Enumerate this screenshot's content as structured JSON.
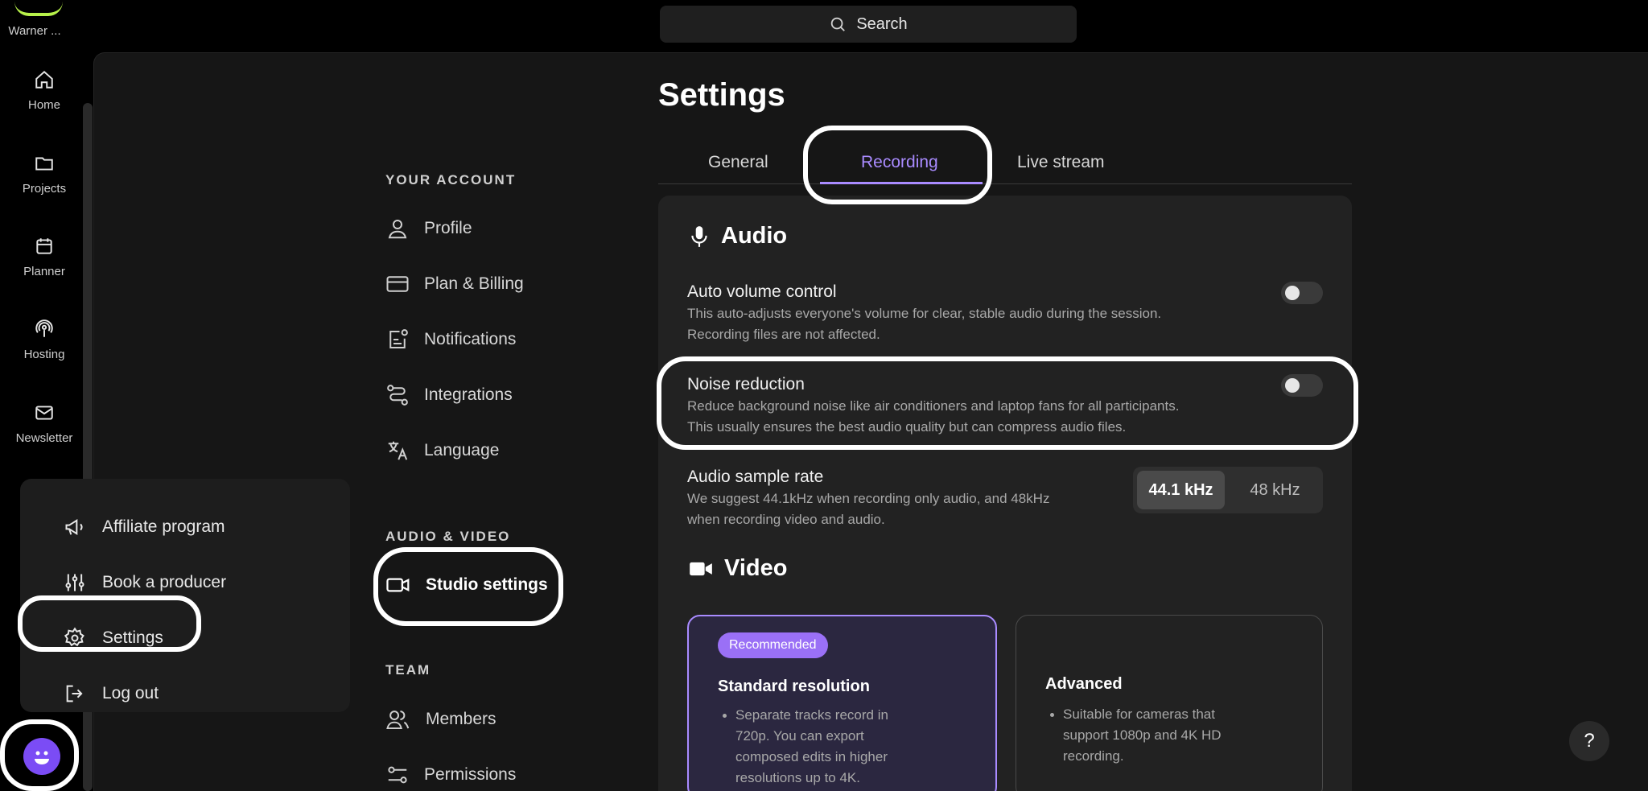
{
  "workspace": {
    "name": "Warner ..."
  },
  "rail": {
    "items": [
      {
        "label": "Home",
        "icon": "home-icon"
      },
      {
        "label": "Projects",
        "icon": "folder-icon"
      },
      {
        "label": "Planner",
        "icon": "calendar-icon"
      },
      {
        "label": "Hosting",
        "icon": "podcast-icon"
      },
      {
        "label": "Newsletter",
        "icon": "mail-icon"
      }
    ]
  },
  "search": {
    "label": "Search"
  },
  "settings_nav": {
    "your_account": {
      "heading": "YOUR ACCOUNT",
      "items": [
        "Profile",
        "Plan & Billing",
        "Notifications",
        "Integrations",
        "Language"
      ]
    },
    "audio_video": {
      "heading": "AUDIO & VIDEO",
      "items": [
        "Studio settings"
      ]
    },
    "team": {
      "heading": "TEAM",
      "items": [
        "Members",
        "Permissions"
      ]
    }
  },
  "page": {
    "title": "Settings",
    "tabs": [
      "General",
      "Recording",
      "Live stream"
    ],
    "active_tab": "Recording"
  },
  "audio": {
    "title": "Audio",
    "auto_volume": {
      "title": "Auto volume control",
      "desc_line1": "This auto-adjusts everyone's volume for clear, stable audio during the session.",
      "desc_line2": "Recording files are not affected.",
      "enabled": false
    },
    "noise_reduction": {
      "title": "Noise reduction",
      "desc_line1": "Reduce background noise like air conditioners and laptop fans for all participants.",
      "desc_line2": "This usually ensures the best audio quality but can compress audio files.",
      "enabled": false
    },
    "sample_rate": {
      "title": "Audio sample rate",
      "desc_line1": "We suggest 44.1kHz when recording only audio, and 48kHz",
      "desc_line2": "when recording video and audio.",
      "options": [
        "44.1 kHz",
        "48 kHz"
      ],
      "selected": "44.1 kHz"
    }
  },
  "video": {
    "title": "Video",
    "standard": {
      "badge": "Recommended",
      "title": "Standard resolution",
      "desc_lines": [
        "Separate tracks record in",
        "720p. You can export",
        "composed edits in higher",
        "resolutions up to 4K."
      ]
    },
    "advanced": {
      "title": "Advanced",
      "desc_lines": [
        "Suitable for cameras that",
        "support 1080p and 4K HD",
        "recording."
      ]
    }
  },
  "menu": {
    "items": [
      "Affiliate program",
      "Book a producer",
      "Settings",
      "Log out"
    ]
  },
  "help": {
    "label": "?"
  },
  "colors": {
    "accent": "#a98bff",
    "brand_logo": "#b7f14a",
    "avatar": "#7b4cf5"
  }
}
